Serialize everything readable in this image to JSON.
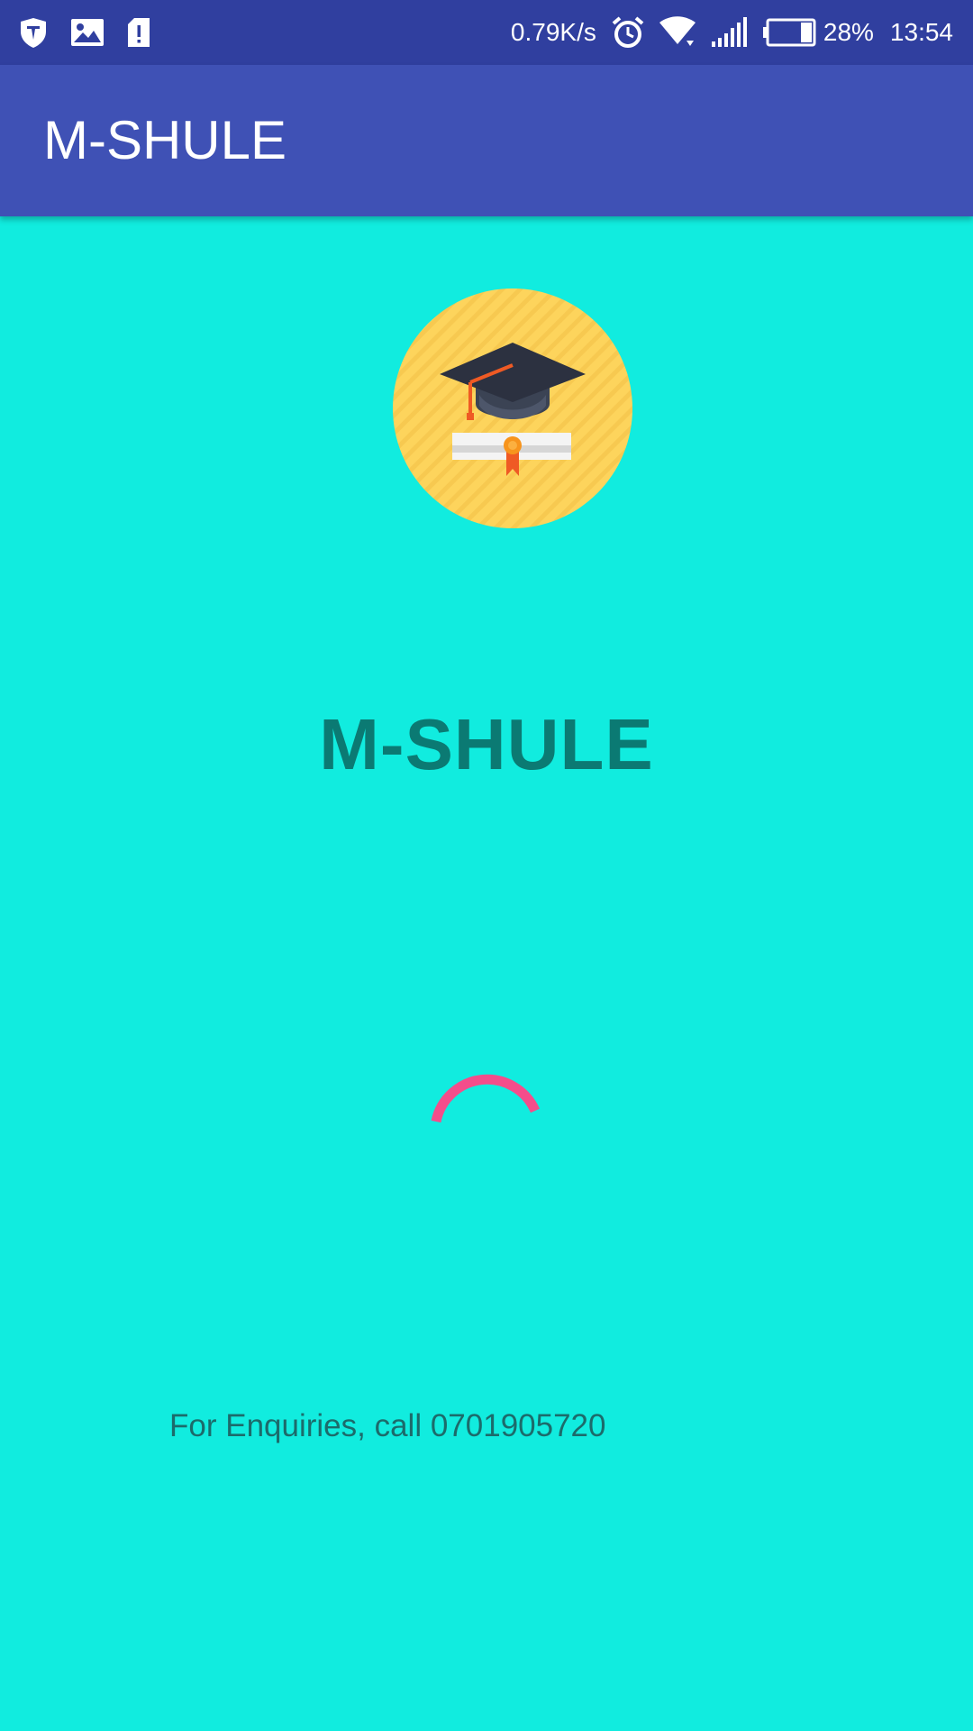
{
  "status_bar": {
    "net_speed": "0.79K/s",
    "battery_percent": "28%",
    "time": "13:54",
    "left_icons": [
      "shield-icon",
      "image-icon",
      "sim-alert-icon"
    ],
    "right_icons": [
      "alarm-icon",
      "wifi-icon",
      "signal-icon",
      "battery-icon"
    ]
  },
  "app_bar": {
    "title": "M-SHULE"
  },
  "splash": {
    "title": "M-SHULE",
    "enquiry_text": "For Enquiries, call 0701905720",
    "logo_icon": "graduation-cap-icon",
    "loading_indicator": "loading-spinner"
  },
  "colors": {
    "status_bar": "#303f9f",
    "app_bar": "#3f51b5",
    "background": "#11ecdf",
    "title_text": "#0b7a73",
    "spinner": "#f44d8b",
    "logo_circle": "#fdd45c"
  }
}
